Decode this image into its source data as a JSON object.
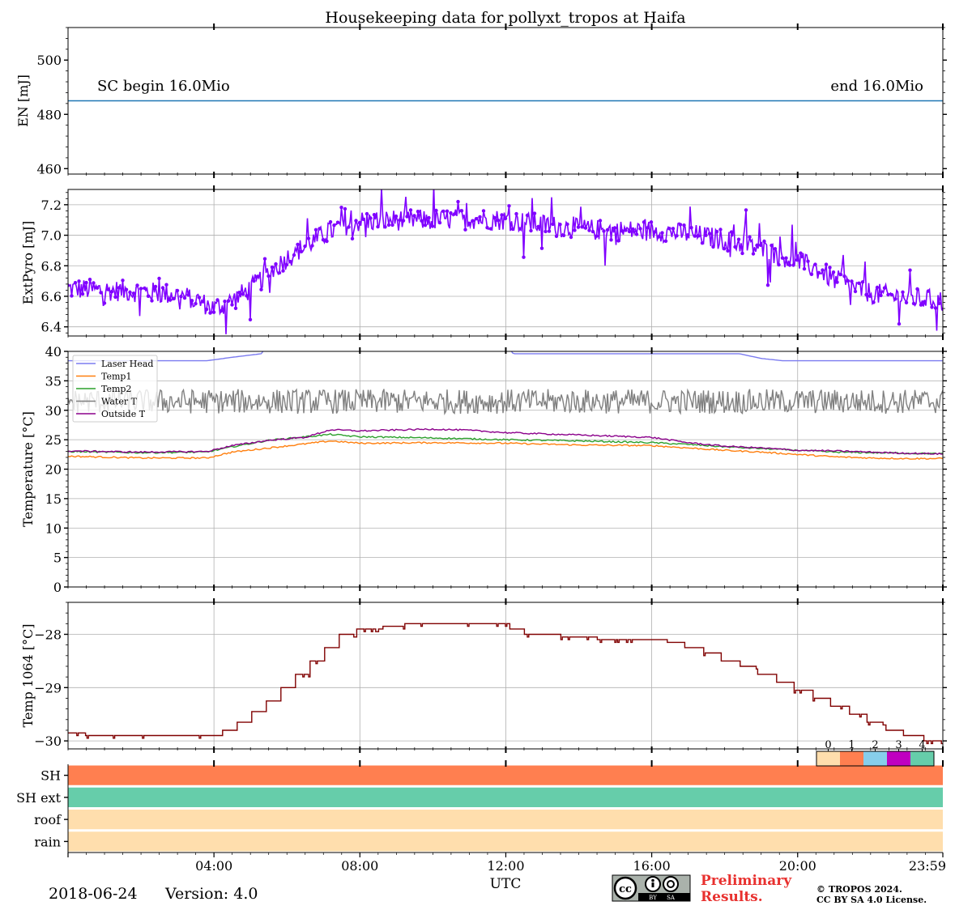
{
  "figure": {
    "title": "Housekeeping data for pollyxt_tropos at Haifa",
    "date": "2018-06-24",
    "version": "Version: 4.0",
    "xlabel": "UTC",
    "x_ticks": [
      "04:00",
      "08:00",
      "12:00",
      "16:00",
      "20:00",
      "23:59"
    ],
    "footer": {
      "preliminary_line1": "Preliminary",
      "preliminary_line2": "Results.",
      "copyright_line1": "© TROPOS 2024.",
      "copyright_line2": "CC BY SA 4.0 License.",
      "cc_badge_by": "BY",
      "cc_badge_sa": "SA",
      "preliminary_color": "#e8312f"
    }
  },
  "chart_data": [
    {
      "id": "energy",
      "type": "line",
      "ylabel": "EN [mJ]",
      "ylim": [
        458,
        512
      ],
      "yticks": [
        460,
        480,
        500
      ],
      "grid": false,
      "annotations": {
        "left": "SC begin 16.0Mio",
        "right": "end 16.0Mio"
      },
      "series": [
        {
          "color": "#1f77b4",
          "x_hours": [
            0,
            23.98
          ],
          "values": [
            485,
            485
          ]
        }
      ]
    },
    {
      "id": "extpyro",
      "type": "line",
      "ylabel": "ExtPyro [mJ]",
      "ylim": [
        6.34,
        7.3
      ],
      "yticks": [
        6.4,
        6.6,
        6.8,
        7.0,
        7.2
      ],
      "ytick_labels": [
        "6.4",
        "6.6",
        "6.8",
        "7.0",
        "7.2"
      ],
      "grid": true,
      "series": [
        {
          "color": "#8000ff",
          "x_hours": [
            0,
            1,
            2,
            3,
            3.5,
            4,
            4.5,
            5,
            5.5,
            6,
            6.5,
            7,
            7.5,
            8,
            9,
            10,
            11,
            12,
            13,
            14,
            15,
            16,
            17,
            18,
            19,
            20,
            20.5,
            21,
            21.5,
            22,
            23,
            23.98
          ],
          "values": [
            6.65,
            6.64,
            6.63,
            6.61,
            6.58,
            6.52,
            6.57,
            6.65,
            6.75,
            6.85,
            6.93,
            7.0,
            7.06,
            7.09,
            7.1,
            7.1,
            7.11,
            7.1,
            7.07,
            7.04,
            7.03,
            7.03,
            7.01,
            6.97,
            6.91,
            6.83,
            6.78,
            6.71,
            6.66,
            6.62,
            6.59,
            6.57
          ]
        }
      ]
    },
    {
      "id": "temperature",
      "type": "line",
      "ylabel": "Temperature [$^\\circ C$]",
      "ylim": [
        0,
        40
      ],
      "yticks": [
        0,
        5,
        10,
        15,
        20,
        25,
        30,
        35,
        40
      ],
      "grid": true,
      "legend_position": "top-left",
      "series": [
        {
          "name": "Laser Head",
          "color": "#7b7bf0",
          "x_hours": [
            0,
            3.8,
            4.5,
            5.3,
            5.4,
            12.1,
            12.2,
            15.9,
            16.1,
            18.4,
            19.0,
            19.6,
            23.98
          ],
          "values": [
            38.4,
            38.4,
            39.0,
            39.6,
            40.5,
            40.5,
            39.6,
            39.6,
            39.6,
            39.6,
            38.8,
            38.4,
            38.4
          ]
        },
        {
          "name": "Temp1",
          "color": "#ff7f0e",
          "x_hours": [
            0,
            2,
            3.8,
            4.5,
            5.5,
            6.5,
            7.2,
            8,
            10,
            12,
            14,
            16,
            17,
            18,
            19,
            20,
            21,
            22,
            23,
            23.98
          ],
          "values": [
            22.2,
            21.9,
            21.9,
            22.9,
            23.6,
            24.3,
            24.8,
            24.4,
            24.5,
            24.4,
            24.1,
            24.0,
            23.6,
            23.2,
            22.9,
            22.5,
            22.1,
            21.9,
            21.8,
            21.8
          ]
        },
        {
          "name": "Temp2",
          "color": "#2ca02c",
          "x_hours": [
            0,
            2,
            3.8,
            4.5,
            5.5,
            6.5,
            7.2,
            8,
            10,
            12,
            14,
            16,
            17,
            18,
            19,
            20,
            21,
            22,
            23,
            23.98
          ],
          "values": [
            23.0,
            22.8,
            22.9,
            23.8,
            24.9,
            25.5,
            25.9,
            25.5,
            25.3,
            25.0,
            24.8,
            24.5,
            24.2,
            23.8,
            23.5,
            23.2,
            22.9,
            22.8,
            22.7,
            22.6
          ]
        },
        {
          "name": "Water T",
          "color": "#808080",
          "x_hours": [
            0,
            23.98
          ],
          "values": [
            31.5,
            31.5
          ]
        },
        {
          "name": "Outside T",
          "color": "#8b008b",
          "x_hours": [
            0,
            2,
            3.8,
            4.5,
            5.5,
            6.5,
            7.2,
            8,
            10,
            11,
            12,
            14,
            16,
            17,
            18,
            19,
            20,
            21,
            22,
            23,
            23.98
          ],
          "values": [
            23.1,
            22.9,
            23.0,
            24.0,
            24.9,
            25.4,
            26.7,
            26.5,
            26.8,
            26.6,
            26.2,
            25.8,
            25.4,
            24.5,
            23.9,
            23.6,
            23.2,
            23.1,
            22.9,
            22.7,
            22.6
          ]
        }
      ]
    },
    {
      "id": "temp1064",
      "type": "line",
      "ylabel": "Temp 1064 [$^\\circ C$]",
      "ylim": [
        -30.15,
        -27.4
      ],
      "yticks": [
        -30,
        -29,
        -28
      ],
      "ytick_labels": [
        "−30",
        "−29",
        "−28"
      ],
      "grid": true,
      "series": [
        {
          "color": "#800000",
          "step": true,
          "x_hours": [
            0,
            0.45,
            1.6,
            3.85,
            4.2,
            4.6,
            5.0,
            5.4,
            5.8,
            6.2,
            6.6,
            7.0,
            7.4,
            7.9,
            8.6,
            9.2,
            11.0,
            12.1,
            12.5,
            13.5,
            14.5,
            16.0,
            16.4,
            16.9,
            17.4,
            17.9,
            18.4,
            18.9,
            19.4,
            19.9,
            20.4,
            20.9,
            21.4,
            21.9,
            22.4,
            22.9,
            23.45,
            23.98
          ],
          "values": [
            -29.85,
            -29.9,
            -29.9,
            -29.9,
            -29.8,
            -29.65,
            -29.45,
            -29.25,
            -29.0,
            -28.75,
            -28.5,
            -28.25,
            -28.0,
            -27.9,
            -27.85,
            -27.8,
            -27.8,
            -27.9,
            -28.0,
            -28.05,
            -28.1,
            -28.1,
            -28.15,
            -28.25,
            -28.35,
            -28.5,
            -28.6,
            -28.75,
            -28.9,
            -29.05,
            -29.2,
            -29.35,
            -29.5,
            -29.65,
            -29.8,
            -29.9,
            -30.0,
            -30.05
          ]
        }
      ]
    },
    {
      "id": "status",
      "type": "heatmap",
      "rows": [
        "SH",
        "SH ext",
        "roof",
        "rain"
      ],
      "row_values": [
        1,
        4,
        0,
        0
      ],
      "colorbar": {
        "ticks": [
          "0",
          "1",
          "2",
          "3",
          "4"
        ],
        "colors": [
          "#ffdead",
          "#ff7f50",
          "#87ceeb",
          "#c000c0",
          "#66cdaa"
        ]
      }
    }
  ]
}
